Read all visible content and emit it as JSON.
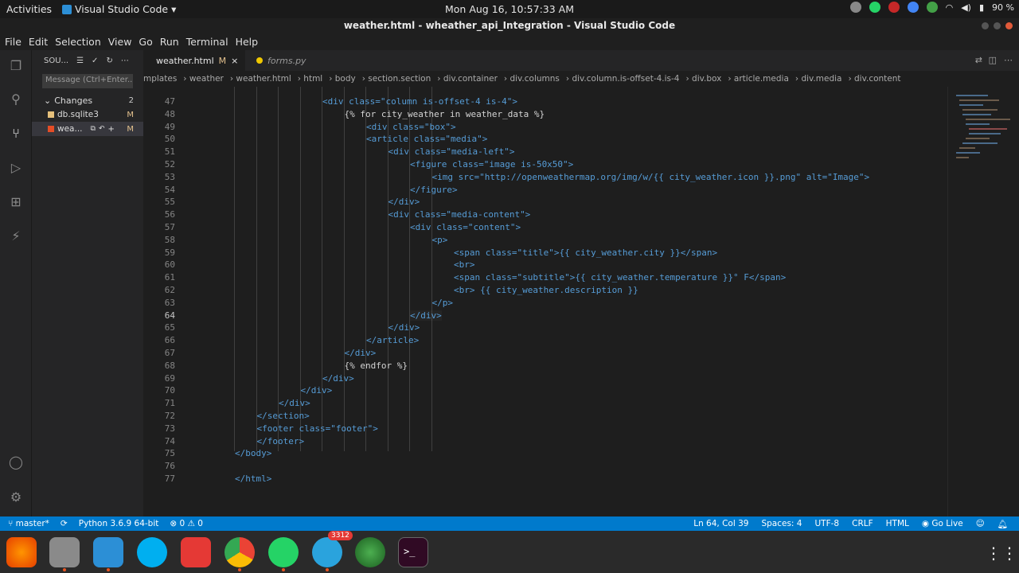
{
  "topbar": {
    "activities": "Activities",
    "app_name": "Visual Studio Code",
    "clock": "Mon Aug 16, 10:57:33 AM",
    "battery": "90 %"
  },
  "window": {
    "title": "weather.html - wheather_api_Integration - Visual Studio Code"
  },
  "menu": [
    "File",
    "Edit",
    "Selection",
    "View",
    "Go",
    "Run",
    "Terminal",
    "Help"
  ],
  "sidebar": {
    "header": "SOU...",
    "message_placeholder": "Message (Ctrl+Enter...",
    "changes_label": "Changes",
    "changes_count": "2",
    "files": [
      {
        "name": "db.sqlite3",
        "status": "M"
      },
      {
        "name": "wea...",
        "status": "M"
      }
    ]
  },
  "tabs": [
    {
      "label": "weather.html",
      "status": "M"
    },
    {
      "label": "forms.py"
    }
  ],
  "breadcrumbs": [
    "mplates",
    "weather",
    "weather.html",
    "html",
    "body",
    "section.section",
    "div.container",
    "div.columns",
    "div.column.is-offset-4.is-4",
    "div.box",
    "article.media",
    "div.media",
    "div.content"
  ],
  "editor": {
    "current_line": "64",
    "lines": [
      {
        "n": "47",
        "code": "<div class=\"column is-offset-4 is-4\">"
      },
      {
        "n": "48",
        "code": "{% for city_weather in weather_data %}"
      },
      {
        "n": "49",
        "code": "<div class=\"box\">"
      },
      {
        "n": "50",
        "code": "<article class=\"media\">"
      },
      {
        "n": "51",
        "code": "<div class=\"media-left\">"
      },
      {
        "n": "52",
        "code": "<figure class=\"image is-50x50\">"
      },
      {
        "n": "53",
        "code": "<img src=\"http://openweathermap.org/img/w/{{ city_weather.icon }}.png\" alt=\"Image\">"
      },
      {
        "n": "54",
        "code": "</figure>"
      },
      {
        "n": "55",
        "code": "</div>"
      },
      {
        "n": "56",
        "code": "<div class=\"media-content\">"
      },
      {
        "n": "57",
        "code": "<div class=\"content\">"
      },
      {
        "n": "58",
        "code": "<p>"
      },
      {
        "n": "59",
        "code": "<span class=\"title\">{{ city_weather.city }}</span>"
      },
      {
        "n": "60",
        "code": "<br>"
      },
      {
        "n": "61",
        "code": "<span class=\"subtitle\">{{ city_weather.temperature }}° F</span>"
      },
      {
        "n": "62",
        "code": "<br> {{ city_weather.description }}"
      },
      {
        "n": "63",
        "code": "</p>"
      },
      {
        "n": "64",
        "code": "</div>"
      },
      {
        "n": "65",
        "code": "</div>"
      },
      {
        "n": "66",
        "code": "</article>"
      },
      {
        "n": "67",
        "code": "</div>"
      },
      {
        "n": "68",
        "code": "{% endfor %}"
      },
      {
        "n": "69",
        "code": "</div>"
      },
      {
        "n": "70",
        "code": "</div>"
      },
      {
        "n": "71",
        "code": "</div>"
      },
      {
        "n": "72",
        "code": "</section>"
      },
      {
        "n": "73",
        "code": "<footer class=\"footer\">"
      },
      {
        "n": "74",
        "code": "</footer>"
      },
      {
        "n": "75",
        "code": "</body>"
      },
      {
        "n": "76",
        "code": ""
      },
      {
        "n": "77",
        "code": "</html>"
      }
    ]
  },
  "statusbar": {
    "branch": "master*",
    "python": "Python 3.6.9 64-bit",
    "errors": "0",
    "warnings": "0",
    "position": "Ln 64, Col 39",
    "spaces": "Spaces: 4",
    "encoding": "UTF-8",
    "eol": "CRLF",
    "language": "HTML",
    "golive": "Go Live"
  },
  "dock": {
    "telegram_badge": "3312"
  }
}
